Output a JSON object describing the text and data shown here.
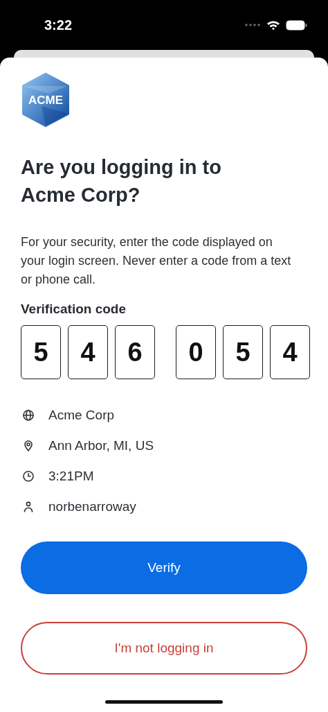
{
  "status_bar": {
    "time": "3:22"
  },
  "logo": {
    "text": "ACME"
  },
  "title": "Are you logging in to Acme Corp?",
  "message": "For your security, enter the code displayed on your login screen. Never enter a code from a text or phone call.",
  "code_label": "Verification code",
  "code_groups": [
    [
      "5",
      "4",
      "6"
    ],
    [
      "0",
      "5",
      "4"
    ]
  ],
  "details": [
    {
      "kind": "organization",
      "text": "Acme Corp"
    },
    {
      "kind": "location",
      "text": "Ann Arbor, MI, US"
    },
    {
      "kind": "time",
      "text": "3:21PM"
    },
    {
      "kind": "user",
      "text": "norbenarroway"
    }
  ],
  "buttons": [
    {
      "kind": "primary",
      "label": "Verify"
    },
    {
      "kind": "danger",
      "label": "I'm not logging in"
    }
  ]
}
